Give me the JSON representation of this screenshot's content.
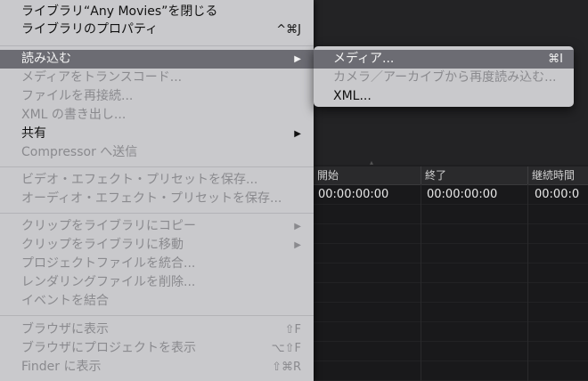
{
  "menu": {
    "items": [
      {
        "label": "ライブラリ“Any Movies”を閉じる",
        "shortcut": "",
        "state": "enabled",
        "submenu": false
      },
      {
        "label": "ライブラリのプロパティ",
        "shortcut": "^⌘J",
        "state": "enabled",
        "submenu": false
      },
      {
        "label": "読み込む",
        "shortcut": "",
        "state": "highlight",
        "submenu": true
      },
      {
        "label": "メディアをトランスコード...",
        "shortcut": "",
        "state": "disabled",
        "submenu": false
      },
      {
        "label": "ファイルを再接続...",
        "shortcut": "",
        "state": "disabled",
        "submenu": false
      },
      {
        "label": "XML の書き出し...",
        "shortcut": "",
        "state": "disabled",
        "submenu": false
      },
      {
        "label": "共有",
        "shortcut": "",
        "state": "enabled",
        "submenu": true
      },
      {
        "label": "Compressor へ送信",
        "shortcut": "",
        "state": "disabled",
        "submenu": false
      },
      {
        "label": "ビデオ・エフェクト・プリセットを保存...",
        "shortcut": "",
        "state": "disabled",
        "submenu": false
      },
      {
        "label": "オーディオ・エフェクト・プリセットを保存...",
        "shortcut": "",
        "state": "disabled",
        "submenu": false
      },
      {
        "label": "クリップをライブラリにコピー",
        "shortcut": "",
        "state": "disabled",
        "submenu": true
      },
      {
        "label": "クリップをライブラリに移動",
        "shortcut": "",
        "state": "disabled",
        "submenu": true
      },
      {
        "label": "プロジェクトファイルを統合...",
        "shortcut": "",
        "state": "disabled",
        "submenu": false
      },
      {
        "label": "レンダリングファイルを削除...",
        "shortcut": "",
        "state": "disabled",
        "submenu": false
      },
      {
        "label": "イベントを結合",
        "shortcut": "",
        "state": "disabled",
        "submenu": false
      },
      {
        "label": "ブラウザに表示",
        "shortcut": "⇧F",
        "state": "disabled",
        "submenu": false
      },
      {
        "label": "ブラウザにプロジェクトを表示",
        "shortcut": "⌥⇧F",
        "state": "disabled",
        "submenu": false
      },
      {
        "label": "Finder に表示",
        "shortcut": "⇧⌘R",
        "state": "disabled",
        "submenu": false
      }
    ],
    "submenu_arrow": "▶"
  },
  "submenu": {
    "items": [
      {
        "label": "メディア...",
        "shortcut": "⌘I",
        "state": "highlight"
      },
      {
        "label": "カメラ／アーカイブから再度読み込む...",
        "shortcut": "",
        "state": "disabled"
      },
      {
        "label": "XML...",
        "shortcut": "",
        "state": "enabled"
      }
    ]
  },
  "table": {
    "headers": [
      "開始",
      "終了",
      "継続時間"
    ],
    "row": [
      "00:00:00:00",
      "00:00:00:00",
      "00:00:0"
    ]
  },
  "colors": {
    "menu_bg": "#c9c9cc",
    "highlight": "#6c6c73",
    "disabled_text": "#8a8a8e"
  }
}
